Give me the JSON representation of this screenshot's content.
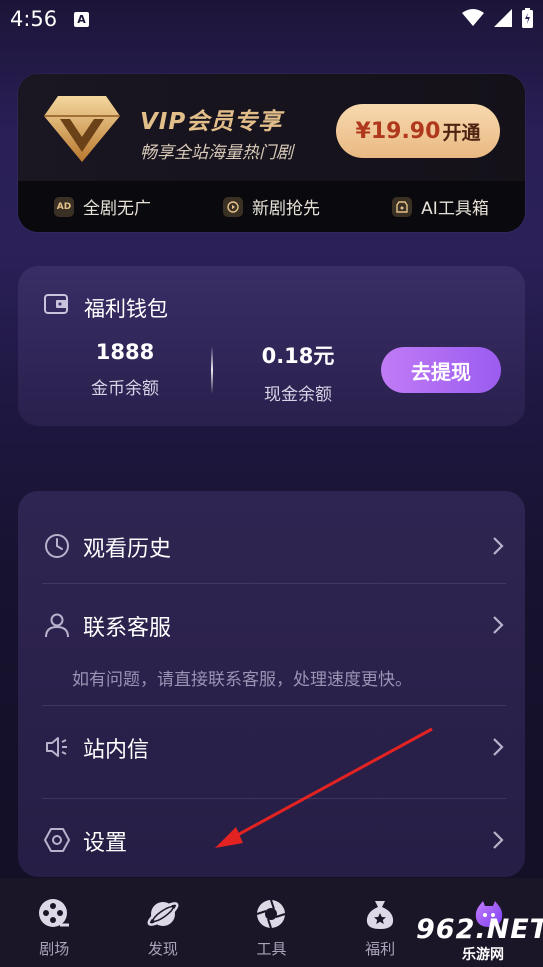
{
  "status_bar": {
    "time": "4:56",
    "notification_letter": "A"
  },
  "vip": {
    "title": "VIP会员专享",
    "subtitle": "畅享全站海量热门剧",
    "price": "¥19.90",
    "open_label": "开通",
    "features": [
      {
        "icon": "ad-icon",
        "badge": "AD",
        "label": "全剧无广"
      },
      {
        "icon": "play-icon",
        "badge": "",
        "label": "新剧抢先"
      },
      {
        "icon": "ai-toolbox-icon",
        "badge": "",
        "label": "AI工具箱"
      }
    ]
  },
  "wallet": {
    "title": "福利钱包",
    "coin_value": "1888",
    "coin_label": "金币余额",
    "cash_value": "0.18元",
    "cash_label": "现金余额",
    "withdraw_label": "去提现"
  },
  "menu": {
    "items": [
      {
        "icon": "clock-icon",
        "label": "观看历史"
      },
      {
        "icon": "person-icon",
        "label": "联系客服"
      },
      {
        "icon": "speaker-icon",
        "label": "站内信"
      },
      {
        "icon": "hexagon-settings-icon",
        "label": "设置"
      }
    ],
    "support_hint": "如有问题，请直接联系客服，处理速度更快。"
  },
  "nav": {
    "items": [
      {
        "icon": "film-reel-icon",
        "label": "剧场"
      },
      {
        "icon": "planet-icon",
        "label": "发现"
      },
      {
        "icon": "aperture-icon",
        "label": "工具"
      },
      {
        "icon": "money-bag-icon",
        "label": "福利"
      },
      {
        "icon": "mascot-icon",
        "label": ""
      }
    ]
  },
  "watermark": {
    "brand": "962.NET",
    "sub": "乐游网"
  },
  "colors": {
    "accent_purple": "#9b5cf0",
    "vip_gold": "#e2be8a",
    "price_red": "#b0391d"
  }
}
